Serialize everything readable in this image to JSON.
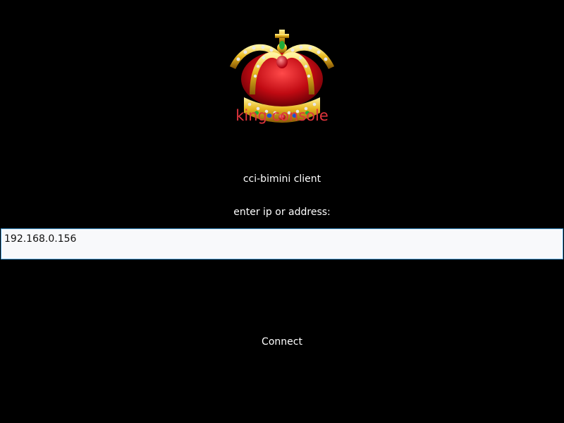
{
  "logo": {
    "icon": "crown-icon",
    "caption": "king console"
  },
  "app": {
    "subtitle": "cci-bimini client",
    "prompt": "enter ip or address:"
  },
  "address_field": {
    "value": "192.168.0.156"
  },
  "actions": {
    "connect_label": "Connect"
  },
  "colors": {
    "background": "#000000",
    "caption_red": "#e0343c",
    "input_border": "#4a9fd8",
    "input_bg": "#f8f9fb"
  }
}
